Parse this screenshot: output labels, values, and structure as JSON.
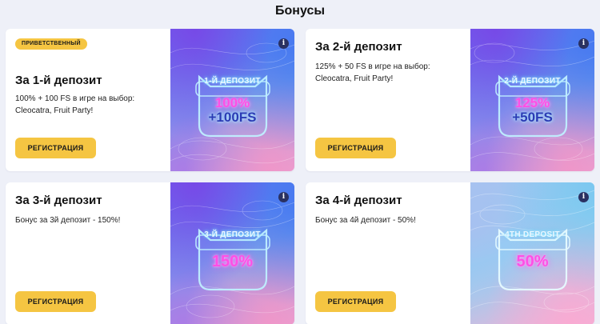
{
  "page": {
    "title": "Бонусы"
  },
  "cards": [
    {
      "badge": "ПРИВЕТСТВЕННЫЙ",
      "title": "За 1-й депозит",
      "description": "100% + 100 FS в игре на выбор: Cleocatra, Fruit Party!",
      "button_label": "РЕГИСТРАЦИЯ",
      "promo": {
        "heading": "1-Й ДЕПОЗИТ",
        "line1": "100%",
        "line2": "+100FS"
      }
    },
    {
      "title": "За 2-й депозит",
      "description": "125% + 50 FS в игре на выбор: Cleocatra, Fruit Party!",
      "button_label": "РЕГИСТРАЦИЯ",
      "promo": {
        "heading": "2-Й ДЕПОЗИТ",
        "line1": "125%",
        "line2": "+50FS"
      }
    },
    {
      "title": "За 3-й депозит",
      "description": "Бонус за 3й депозит - 150%!",
      "button_label": "РЕГИСТРАЦИЯ",
      "promo": {
        "heading": "3-Й ДЕПОЗИТ",
        "line1": "150%"
      }
    },
    {
      "title": "За 4-й депозит",
      "description": "Бонус за 4й депозит - 50%!",
      "button_label": "РЕГИСТРАЦИЯ",
      "promo": {
        "heading": "4TH DEPOSIT",
        "line1": "50%"
      }
    }
  ],
  "icons": {
    "info": "info-icon"
  },
  "colors": {
    "accent": "#f5c542",
    "background": "#eef0f8",
    "card": "#ffffff",
    "neon_pink": "#ff4fe6",
    "neon_blue": "#2b3bb5"
  }
}
